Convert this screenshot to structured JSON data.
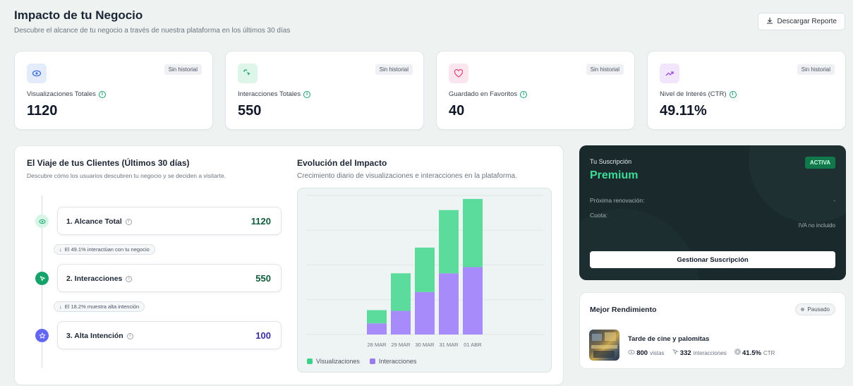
{
  "header": {
    "title": "Impacto de tu Negocio",
    "subtitle": "Descubre el alcance de tu negocio a través de nuestra plataforma en los últimos 30 días",
    "download_label": "Descargar Reporte"
  },
  "stats": [
    {
      "label": "Visualizaciones Totales",
      "value": "1120",
      "badge": "Sin historial",
      "icon": "eye-icon",
      "color": "#3b6fe0"
    },
    {
      "label": "Interacciones Totales",
      "value": "550",
      "badge": "Sin historial",
      "icon": "cursor-click-icon",
      "color": "#16a36b"
    },
    {
      "label": "Guardado en Favoritos",
      "value": "40",
      "badge": "Sin historial",
      "icon": "heart-icon",
      "color": "#e0447c"
    },
    {
      "label": "Nivel de Interés (CTR)",
      "value": "49.11%",
      "badge": "Sin historial",
      "icon": "trending-up-icon",
      "color": "#9b4de0"
    }
  ],
  "journey": {
    "title": "El Viaje de tus Clientes (Últimos 30 días)",
    "subtitle": "Descubre cómo los usuarios descubren tu negocio y se deciden a visitarte.",
    "steps": [
      {
        "label": "1. Alcance Total",
        "value": "1120",
        "color": "#0f5c3a"
      },
      {
        "label": "2. Interacciones",
        "value": "550",
        "color": "#0f5c3a"
      },
      {
        "label": "3. Alta Intención",
        "value": "100",
        "color": "#3730a3"
      }
    ],
    "transitions": [
      "El 49.1% interactúan con tu negocio",
      "El 18.2% muestra alta intención"
    ]
  },
  "evolution": {
    "title": "Evolución del Impacto",
    "subtitle": "Crecimiento diario de visualizaciones e interacciones en la plataforma."
  },
  "chart_data": {
    "type": "bar",
    "stacked": true,
    "categories": [
      "28 MAR",
      "29 MAR",
      "30 MAR",
      "31 MAR",
      "01 ABR"
    ],
    "series": [
      {
        "name": "Interacciones",
        "values": [
          16,
          34,
          61,
          88,
          97
        ],
        "color": "#a78bfa"
      },
      {
        "name": "Visualizaciones",
        "values": [
          19,
          54,
          64,
          91,
          98
        ],
        "color": "#5cdc9c"
      }
    ],
    "ylim": [
      0,
      200
    ],
    "grid": true,
    "legend": "bottom-left"
  },
  "subscription": {
    "label": "Tu Suscripción",
    "plan": "Premium",
    "status": "ACTIVA",
    "renewal_label": "Próxima renovación:",
    "renewal_value": "-",
    "quota_label": "Cuota:",
    "tax_note": "IVA no incluido",
    "manage_label": "Gestionar Suscripción"
  },
  "best": {
    "title": "Mejor Rendimiento",
    "status": "Pausado",
    "event_name": "Tarde de cine y palomitas",
    "views": "800",
    "views_label": "vistas",
    "interactions": "332",
    "interactions_label": "interacciones",
    "ctr": "41.5%",
    "ctr_label": "CTR"
  }
}
